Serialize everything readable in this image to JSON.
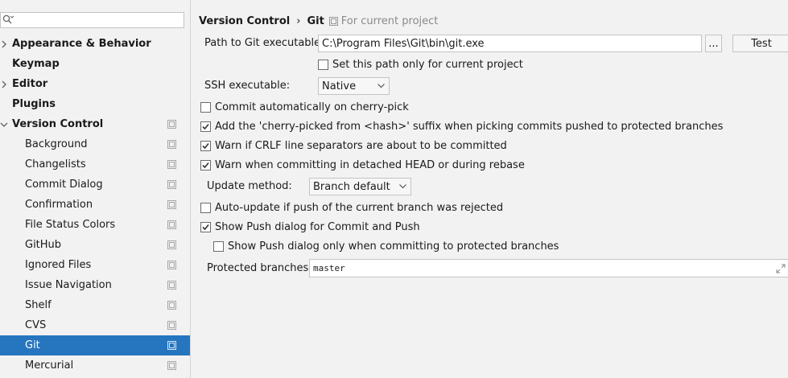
{
  "search": {
    "placeholder": ""
  },
  "tree": [
    {
      "label": "Appearance & Behavior",
      "level": "top",
      "arrow": "right",
      "project": false,
      "selected": false
    },
    {
      "label": "Keymap",
      "level": "top",
      "arrow": "none",
      "project": false,
      "selected": false
    },
    {
      "label": "Editor",
      "level": "top",
      "arrow": "right",
      "project": false,
      "selected": false
    },
    {
      "label": "Plugins",
      "level": "top",
      "arrow": "none",
      "project": false,
      "selected": false
    },
    {
      "label": "Version Control",
      "level": "top",
      "arrow": "down",
      "project": true,
      "selected": false
    },
    {
      "label": "Background",
      "level": "child",
      "arrow": "none",
      "project": true,
      "selected": false
    },
    {
      "label": "Changelists",
      "level": "child",
      "arrow": "none",
      "project": true,
      "selected": false
    },
    {
      "label": "Commit Dialog",
      "level": "child",
      "arrow": "none",
      "project": true,
      "selected": false
    },
    {
      "label": "Confirmation",
      "level": "child",
      "arrow": "none",
      "project": true,
      "selected": false
    },
    {
      "label": "File Status Colors",
      "level": "child",
      "arrow": "none",
      "project": true,
      "selected": false
    },
    {
      "label": "GitHub",
      "level": "child",
      "arrow": "none",
      "project": true,
      "selected": false
    },
    {
      "label": "Ignored Files",
      "level": "child",
      "arrow": "none",
      "project": true,
      "selected": false
    },
    {
      "label": "Issue Navigation",
      "level": "child",
      "arrow": "none",
      "project": true,
      "selected": false
    },
    {
      "label": "Shelf",
      "level": "child",
      "arrow": "none",
      "project": true,
      "selected": false
    },
    {
      "label": "CVS",
      "level": "child",
      "arrow": "none",
      "project": true,
      "selected": false
    },
    {
      "label": "Git",
      "level": "child",
      "arrow": "none",
      "project": true,
      "selected": true
    },
    {
      "label": "Mercurial",
      "level": "child",
      "arrow": "none",
      "project": true,
      "selected": false
    }
  ],
  "breadcrumb": {
    "parent": "Version Control",
    "separator": "›",
    "current": "Git",
    "scope_note": "For current project"
  },
  "git": {
    "path_label": "Path to Git executable:",
    "path_value": "C:\\Program Files\\Git\\bin\\git.exe",
    "browse_label": "...",
    "test_label": "Test",
    "path_only_project": {
      "label": "Set this path only for current project",
      "checked": false
    },
    "ssh_label": "SSH executable:",
    "ssh_value": "Native",
    "options": [
      {
        "label": "Commit automatically on cherry-pick",
        "checked": false
      },
      {
        "label": "Add the 'cherry-picked from <hash>' suffix when picking commits pushed to protected branches",
        "checked": true
      },
      {
        "label": "Warn if CRLF line separators are about to be committed",
        "checked": true
      },
      {
        "label": "Warn when committing in detached HEAD or during rebase",
        "checked": true
      }
    ],
    "update_label": "Update method:",
    "update_value": "Branch default",
    "auto_update": {
      "label": "Auto-update if push of the current branch was rejected",
      "checked": false
    },
    "show_push": {
      "label": "Show Push dialog for Commit and Push",
      "checked": true
    },
    "show_push_protected": {
      "label": "Show Push dialog only when committing to protected branches",
      "checked": false
    },
    "protected_label": "Protected branches:",
    "protected_value": "master"
  },
  "colors": {
    "selection": "#2675bf",
    "background": "#f2f2f2",
    "field": "#ffffff"
  }
}
